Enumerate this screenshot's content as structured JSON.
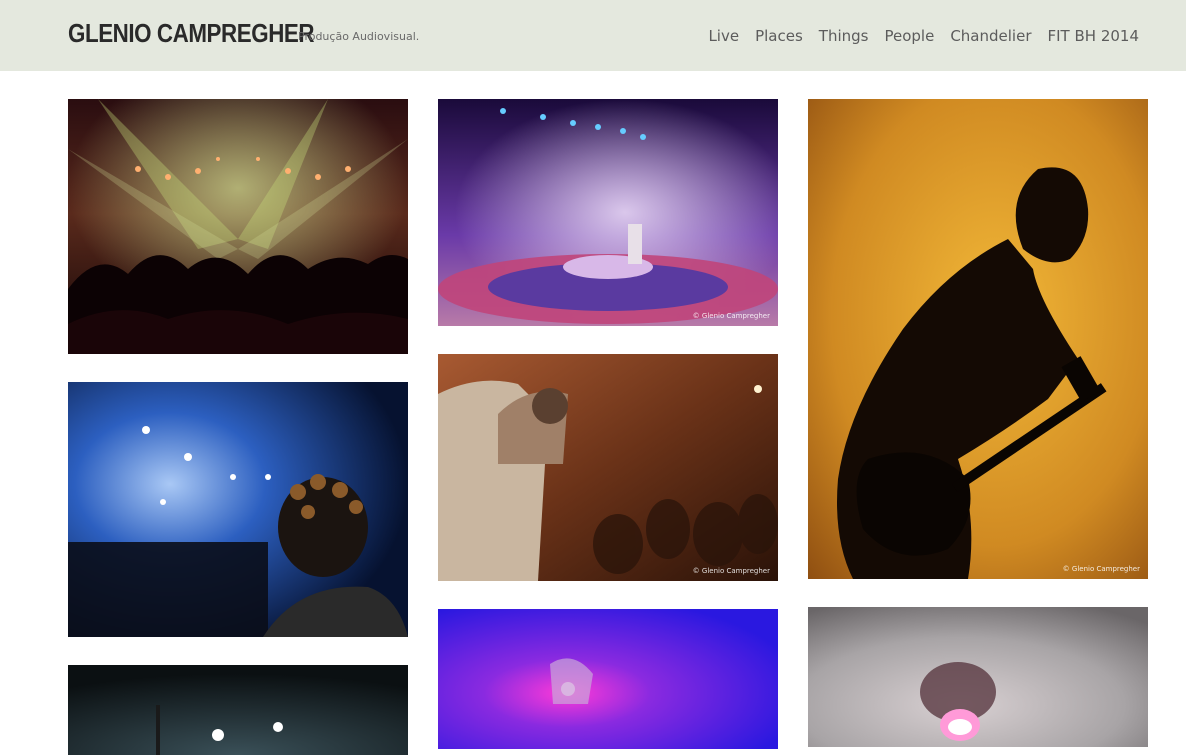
{
  "site": {
    "brand": "GLENIO CAMPREGHER",
    "tagline": "Produção Audiovisual."
  },
  "nav": {
    "items": [
      {
        "label": "Live"
      },
      {
        "label": "Places"
      },
      {
        "label": "Things"
      },
      {
        "label": "People"
      },
      {
        "label": "Chandelier"
      },
      {
        "label": "FIT BH 2014"
      }
    ]
  },
  "gallery": {
    "watermark": "© Glenio Campregher",
    "photos": [
      {
        "subject": "concert-crowd-green-lights"
      },
      {
        "subject": "stage-purple-spotlights-circle-floor"
      },
      {
        "subject": "guitarist-silhouette-orange"
      },
      {
        "subject": "singer-blue-stage-braided-hair"
      },
      {
        "subject": "painted-performer-theater-audience"
      },
      {
        "subject": "magenta-light-performer"
      },
      {
        "subject": "crowd-hands-stage"
      },
      {
        "subject": "smoke-performer-mask"
      }
    ]
  },
  "colors": {
    "header_bg": "#e4e8de",
    "text_dark": "#2a2a2a",
    "nav_text": "#5c5c5c"
  }
}
